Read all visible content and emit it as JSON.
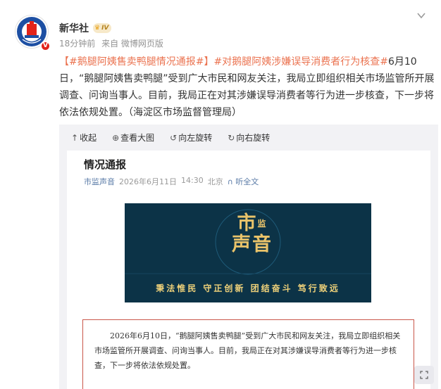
{
  "account": {
    "name": "新华社",
    "level_badge": "IV",
    "verified_badge": "V",
    "avatar_text": "XINHUA",
    "avatar_icon": "xinhua-logo-icon"
  },
  "meta": {
    "time": "18分钟前",
    "source": "来自 微博网页版"
  },
  "post": {
    "tag1": "【#鹅腿阿姨售卖鸭腿情况通报#】",
    "tag2": "#对鹅腿阿姨涉嫌误导消费者行为核查#",
    "text": "6月10日，“鹅腿阿姨售卖鸭腿”受到广大市民和网友关注，我局立即组织相关市场监管所开展调查、问询当事人。目前，我局正在对其涉嫌误导消费者等行为进一步核查，下一步将依法依规处置。（海淀区市场监督管理局）"
  },
  "toolbar": {
    "collapse": "收起",
    "view_large": "查看大图",
    "rotate_left": "向左旋转",
    "rotate_right": "向右旋转"
  },
  "doc": {
    "title": "情况通报",
    "source": "市监声音",
    "date": "2026年6月11日",
    "time": "14:30",
    "location": "北京",
    "listen": "听全文",
    "logo_top": "市",
    "logo_small": "监",
    "logo_bottom": "声音",
    "slogan": "秉法惟民  守正创新  团结奋斗  笃行致远",
    "body": "2026年6月10日，“鹅腿阿姨售卖鸭腿”受到广大市民和网友关注，我局立即组织相关市场监管所开展调查、问询当事人。目前，我局正在对其涉嫌误导消费者等行为进一步核查，下一步将依法依规处置。"
  },
  "colors": {
    "tag": "#eb7350",
    "banner_bg": "#0c3347",
    "logo_gold": "#e9c36a",
    "box_border": "#c9564a"
  }
}
